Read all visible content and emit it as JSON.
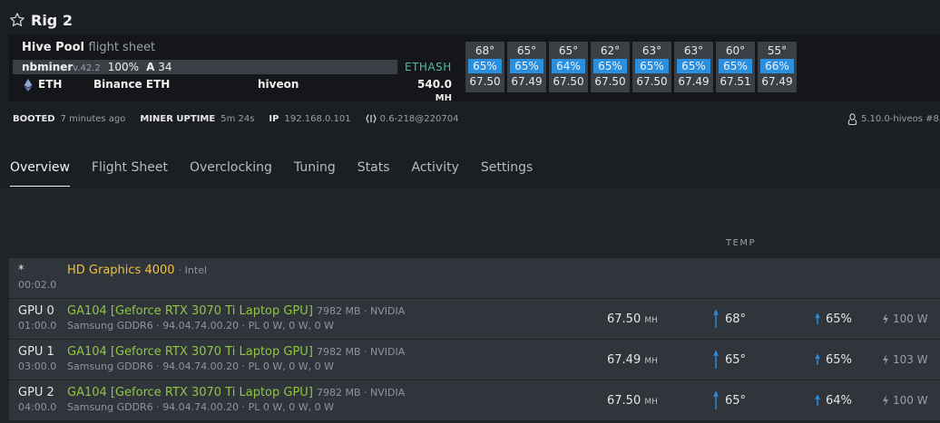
{
  "rig": {
    "name": "Rig 2"
  },
  "flight_sheet": {
    "pool": "Hive Pool",
    "label": "flight sheet",
    "miner": "nbminer",
    "miner_version": "v.42.2",
    "share_pct": "100%",
    "accepted_prefix": "A",
    "accepted": "34",
    "algo": "ETHASH",
    "coin": "ETH",
    "pool_name": "Binance ETH",
    "wallet": "hiveon",
    "total_hashrate": "540.0",
    "total_unit": "MH"
  },
  "gpu_cards": [
    {
      "temp": "68°",
      "fan": "65%",
      "hash": "67.50"
    },
    {
      "temp": "65°",
      "fan": "65%",
      "hash": "67.49"
    },
    {
      "temp": "65°",
      "fan": "64%",
      "hash": "67.50"
    },
    {
      "temp": "62°",
      "fan": "65%",
      "hash": "67.50"
    },
    {
      "temp": "63°",
      "fan": "65%",
      "hash": "67.50"
    },
    {
      "temp": "63°",
      "fan": "65%",
      "hash": "67.49"
    },
    {
      "temp": "60°",
      "fan": "65%",
      "hash": "67.51"
    },
    {
      "temp": "55°",
      "fan": "66%",
      "hash": "67.49"
    }
  ],
  "status": {
    "booted_label": "BOOTED",
    "booted_value": "7 minutes ago",
    "uptime_label": "MINER UPTIME",
    "uptime_value": "5m 24s",
    "ip_label": "IP",
    "ip_value": "192.168.0.101",
    "version": "0.6-218@220704",
    "kernel": "5.10.0-hiveos #8"
  },
  "tabs": [
    {
      "label": "Overview"
    },
    {
      "label": "Flight Sheet"
    },
    {
      "label": "Overclocking"
    },
    {
      "label": "Tuning"
    },
    {
      "label": "Stats"
    },
    {
      "label": "Activity"
    },
    {
      "label": "Settings"
    }
  ],
  "table": {
    "temp_header": "TEMP"
  },
  "igpu": {
    "index": "*",
    "bus": "00:02.0",
    "name": "HD Graphics 4000",
    "vendor": "· Intel"
  },
  "gpus": [
    {
      "index": "GPU 0",
      "bus": "01:00.0",
      "name": "GA104 [Geforce RTX 3070 Ti Laptop GPU]",
      "mem": "7982 MB · NVIDIA",
      "info": "Samsung GDDR6 · 94.04.74.00.20 · PL 0 W, 0 W, 0 W",
      "hashrate": "67.50",
      "unit": "MH",
      "temp": "68°",
      "fan": "65%",
      "power": "100 W"
    },
    {
      "index": "GPU 1",
      "bus": "03:00.0",
      "name": "GA104 [Geforce RTX 3070 Ti Laptop GPU]",
      "mem": "7982 MB · NVIDIA",
      "info": "Samsung GDDR6 · 94.04.74.00.20 · PL 0 W, 0 W, 0 W",
      "hashrate": "67.49",
      "unit": "MH",
      "temp": "65°",
      "fan": "65%",
      "power": "103 W"
    },
    {
      "index": "GPU 2",
      "bus": "04:00.0",
      "name": "GA104 [Geforce RTX 3070 Ti Laptop GPU]",
      "mem": "7982 MB · NVIDIA",
      "info": "Samsung GDDR6 · 94.04.74.00.20 · PL 0 W, 0 W, 0 W",
      "hashrate": "67.50",
      "unit": "MH",
      "temp": "65°",
      "fan": "64%",
      "power": "100 W"
    }
  ],
  "colors": {
    "accent_blue": "#2b8fe0",
    "algo_green": "#4fbf9f",
    "gpu_green": "#8ec641",
    "igpu_yellow": "#f3c03a"
  }
}
